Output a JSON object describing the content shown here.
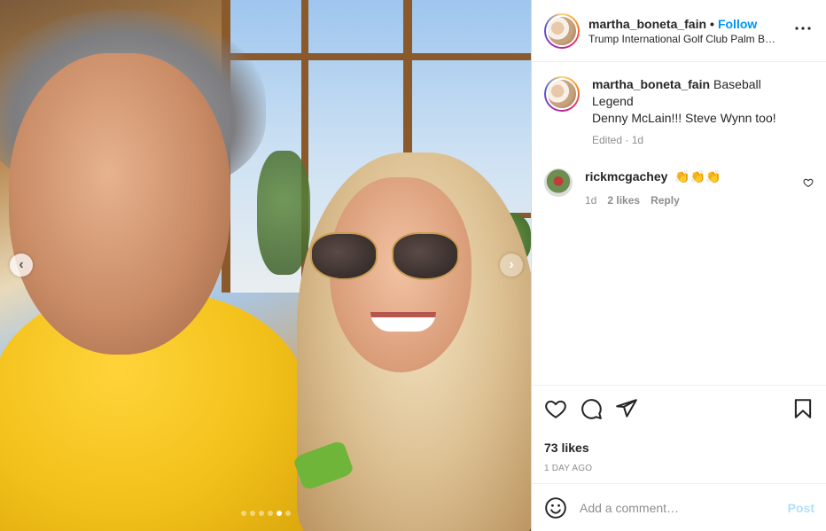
{
  "post": {
    "username": "martha_boneta_fain",
    "separator": "•",
    "follow_label": "Follow",
    "location": "Trump International Golf Club Palm B…",
    "more_label": "•••"
  },
  "media": {
    "prev_label": "‹",
    "next_label": "›",
    "slide_count": 6,
    "active_slide": 5
  },
  "caption": {
    "username": "martha_boneta_fain",
    "line1": "Baseball",
    "line2": "Legend",
    "line3": "Denny McLain!!! Steve Wynn too!",
    "meta": "Edited · 1d"
  },
  "comments": [
    {
      "username": "rickmcgachey",
      "text": "👏👏👏",
      "age": "1d",
      "likes": "2 likes",
      "reply_label": "Reply"
    }
  ],
  "actions": {
    "likes": "73 likes",
    "timestamp": "1 DAY AGO"
  },
  "composer": {
    "placeholder": "Add a comment…",
    "post_label": "Post"
  }
}
